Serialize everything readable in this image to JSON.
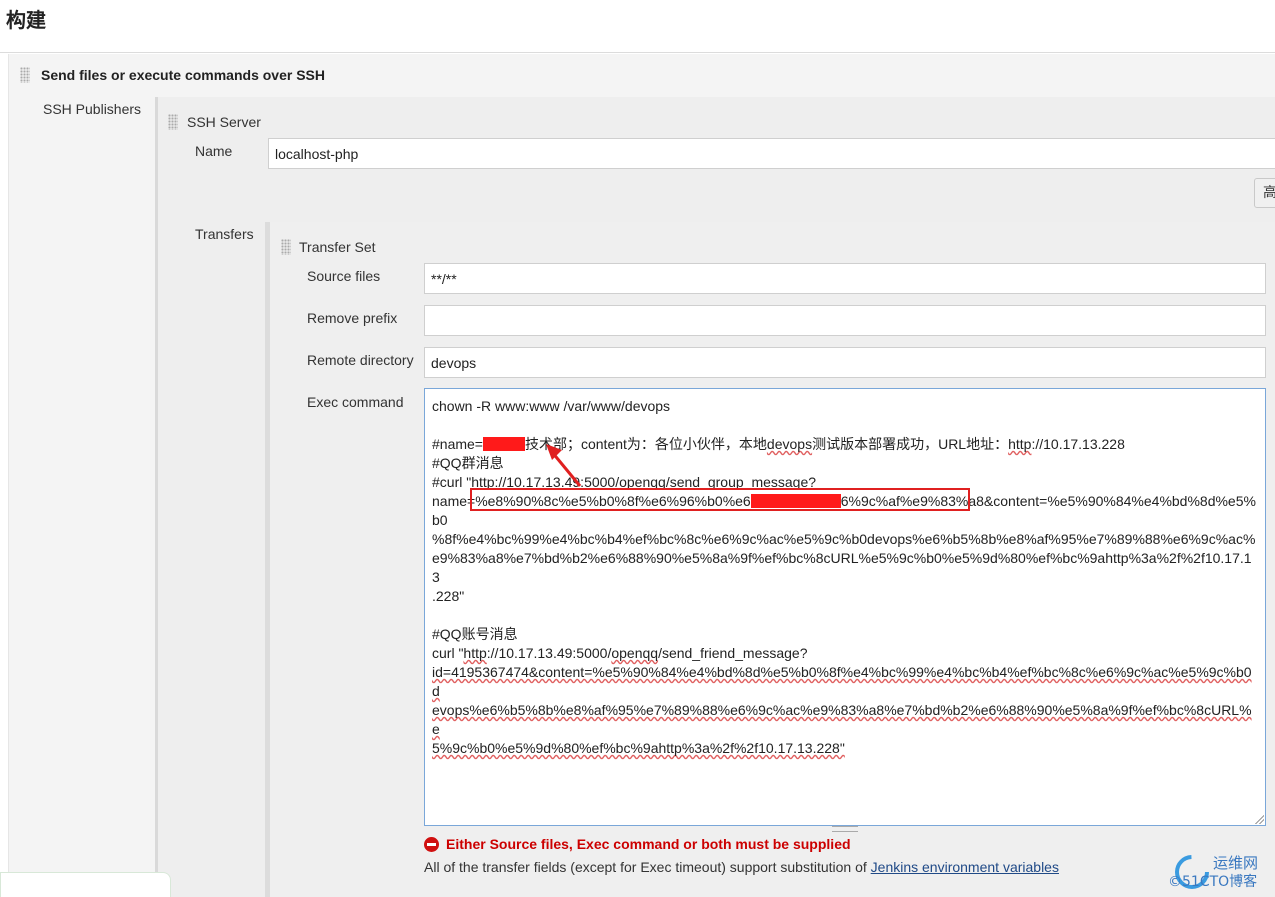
{
  "section": {
    "title": "构建"
  },
  "step": {
    "title": "Send files or execute commands over SSH"
  },
  "publishers": {
    "label": "SSH Publishers"
  },
  "server": {
    "title": "SSH Server",
    "name_label": "Name",
    "name_value": "localhost-php",
    "advanced_label": "高"
  },
  "transfers": {
    "label": "Transfers",
    "set_title": "Transfer Set",
    "source_label": "Source files",
    "source_value": "**/**",
    "prefix_label": "Remove prefix",
    "prefix_value": "",
    "remote_label": "Remote directory",
    "remote_value": "devops",
    "exec_label": "Exec command",
    "exec_lines": {
      "l1": "chown -R www:www /var/www/devops",
      "l3a": "#name=",
      "l3b": "技术部；content为：各位小伙伴，本地",
      "l3c": "devops",
      "l3d": "测试版本部署成功，URL地址：",
      "l3e": "http",
      "l3f": "://10.17.13.228",
      "l4": "#QQ群消息",
      "l5": "#curl \"http://10.17.13.49:5000/openqq/send_group_message?",
      "l6a": "name=%e8%90%8c%e5%b0%8f%e6%96%b0%e6",
      "l6b": "6%9c%af%e9%83%a8&content=%e5%90%84%e4%bd%8d%e5%b0",
      "l7": "%8f%e4%bc%99%e4%bc%b4%ef%bc%8c%e6%9c%ac%e5%9c%b0devops%e6%b5%8b%e8%af%95%e7%89%88%e6%9c%ac%",
      "l8": "e9%83%a8%e7%bd%b2%e6%88%90%e5%8a%9f%ef%bc%8cURL%e5%9c%b0%e5%9d%80%ef%bc%9ahttp%3a%2f%2f10.17.13",
      "l9": ".228\"",
      "l11": "#QQ账号消息",
      "l12a": "curl \"",
      "l12b": "http",
      "l12c": "://10.17.13.49:5000/",
      "l12d": "openqq",
      "l12e": "/send_friend_message?",
      "l13a": "id=4195367474&content=%e5%90%84%e4%bd%8d%e5%b0%8f%e4%bc%99%e4%bc%b4%ef%bc%8c%e6%9c%ac%e5%9c%b0d",
      "l14a": "evops%e6%b5%8b%e8%af%95%e7%89%88%e6%9c%ac%e9%83%a8%e7%bd%b2%e6%88%90%e5%8a%9f%ef%bc%8cURL%e",
      "l15a": "5%9c%b0%e5%9d%80%ef%bc%9ahttp%3a%2f%2f10.17.13.228\""
    }
  },
  "validation": {
    "error": "Either Source files, Exec command or both must be supplied",
    "help_prefix": "All of the transfer fields (except for Exec timeout) support substitution of ",
    "help_link": "Jenkins environment variables"
  },
  "watermark": {
    "line1": "运维网",
    "line2": "©51CTO博客"
  },
  "colors": {
    "error": "#cc0000",
    "link": "#204a87",
    "focus_border": "#7aa7d9",
    "annotation": "#e02020"
  }
}
